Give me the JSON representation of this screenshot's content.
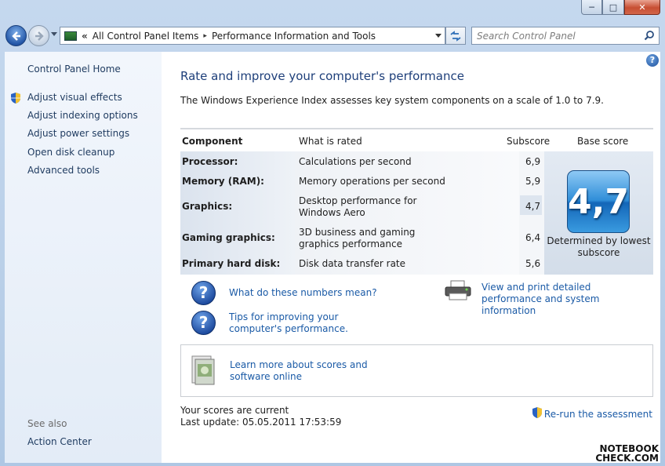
{
  "window": {
    "minimize": "─",
    "maximize": "□",
    "close": "✕"
  },
  "address": {
    "overflow": "«",
    "crumbs": [
      "All Control Panel Items",
      "Performance Information and Tools"
    ],
    "separator": "▸"
  },
  "search": {
    "placeholder": "Search Control Panel"
  },
  "sidebar": {
    "home": "Control Panel Home",
    "items": [
      {
        "label": "Adjust visual effects",
        "icon": "shield-icon"
      },
      {
        "label": "Adjust indexing options"
      },
      {
        "label": "Adjust power settings"
      },
      {
        "label": "Open disk cleanup"
      },
      {
        "label": "Advanced tools"
      }
    ],
    "see_also": "See also",
    "action_center": "Action Center"
  },
  "main": {
    "help": "?",
    "title": "Rate and improve your computer's performance",
    "description": "The Windows Experience Index assesses key system components on a scale of 1.0 to 7.9.",
    "table": {
      "headers": {
        "component": "Component",
        "what": "What is rated",
        "subscore": "Subscore",
        "base": "Base score"
      },
      "rows": [
        {
          "component": "Processor:",
          "what": "Calculations per second",
          "subscore": "6,9"
        },
        {
          "component": "Memory (RAM):",
          "what": "Memory operations per second",
          "subscore": "5,9"
        },
        {
          "component": "Graphics:",
          "what": "Desktop performance for Windows Aero",
          "subscore": "4,7"
        },
        {
          "component": "Gaming graphics:",
          "what": "3D business and gaming graphics performance",
          "subscore": "6,4"
        },
        {
          "component": "Primary hard disk:",
          "what": "Disk data transfer rate",
          "subscore": "5,6"
        }
      ],
      "base_score": "4,7",
      "determined_by": "Determined by lowest subscore"
    },
    "links": {
      "numbers": "What do these numbers mean?",
      "tips": "Tips for improving your computer's performance.",
      "print": "View and print detailed performance and system information",
      "learn": "Learn more about scores and software online"
    },
    "status": {
      "current": "Your scores are current",
      "last_update": "Last update: 05.05.2011 17:53:59"
    },
    "rerun": "Re-run the assessment"
  },
  "watermark": {
    "line1": "NOTEBOOK",
    "line2": "CHECK.COM"
  },
  "colors": {
    "link": "#1a5aa6",
    "title": "#1e3f7a",
    "badge": "#2f8ed8"
  }
}
